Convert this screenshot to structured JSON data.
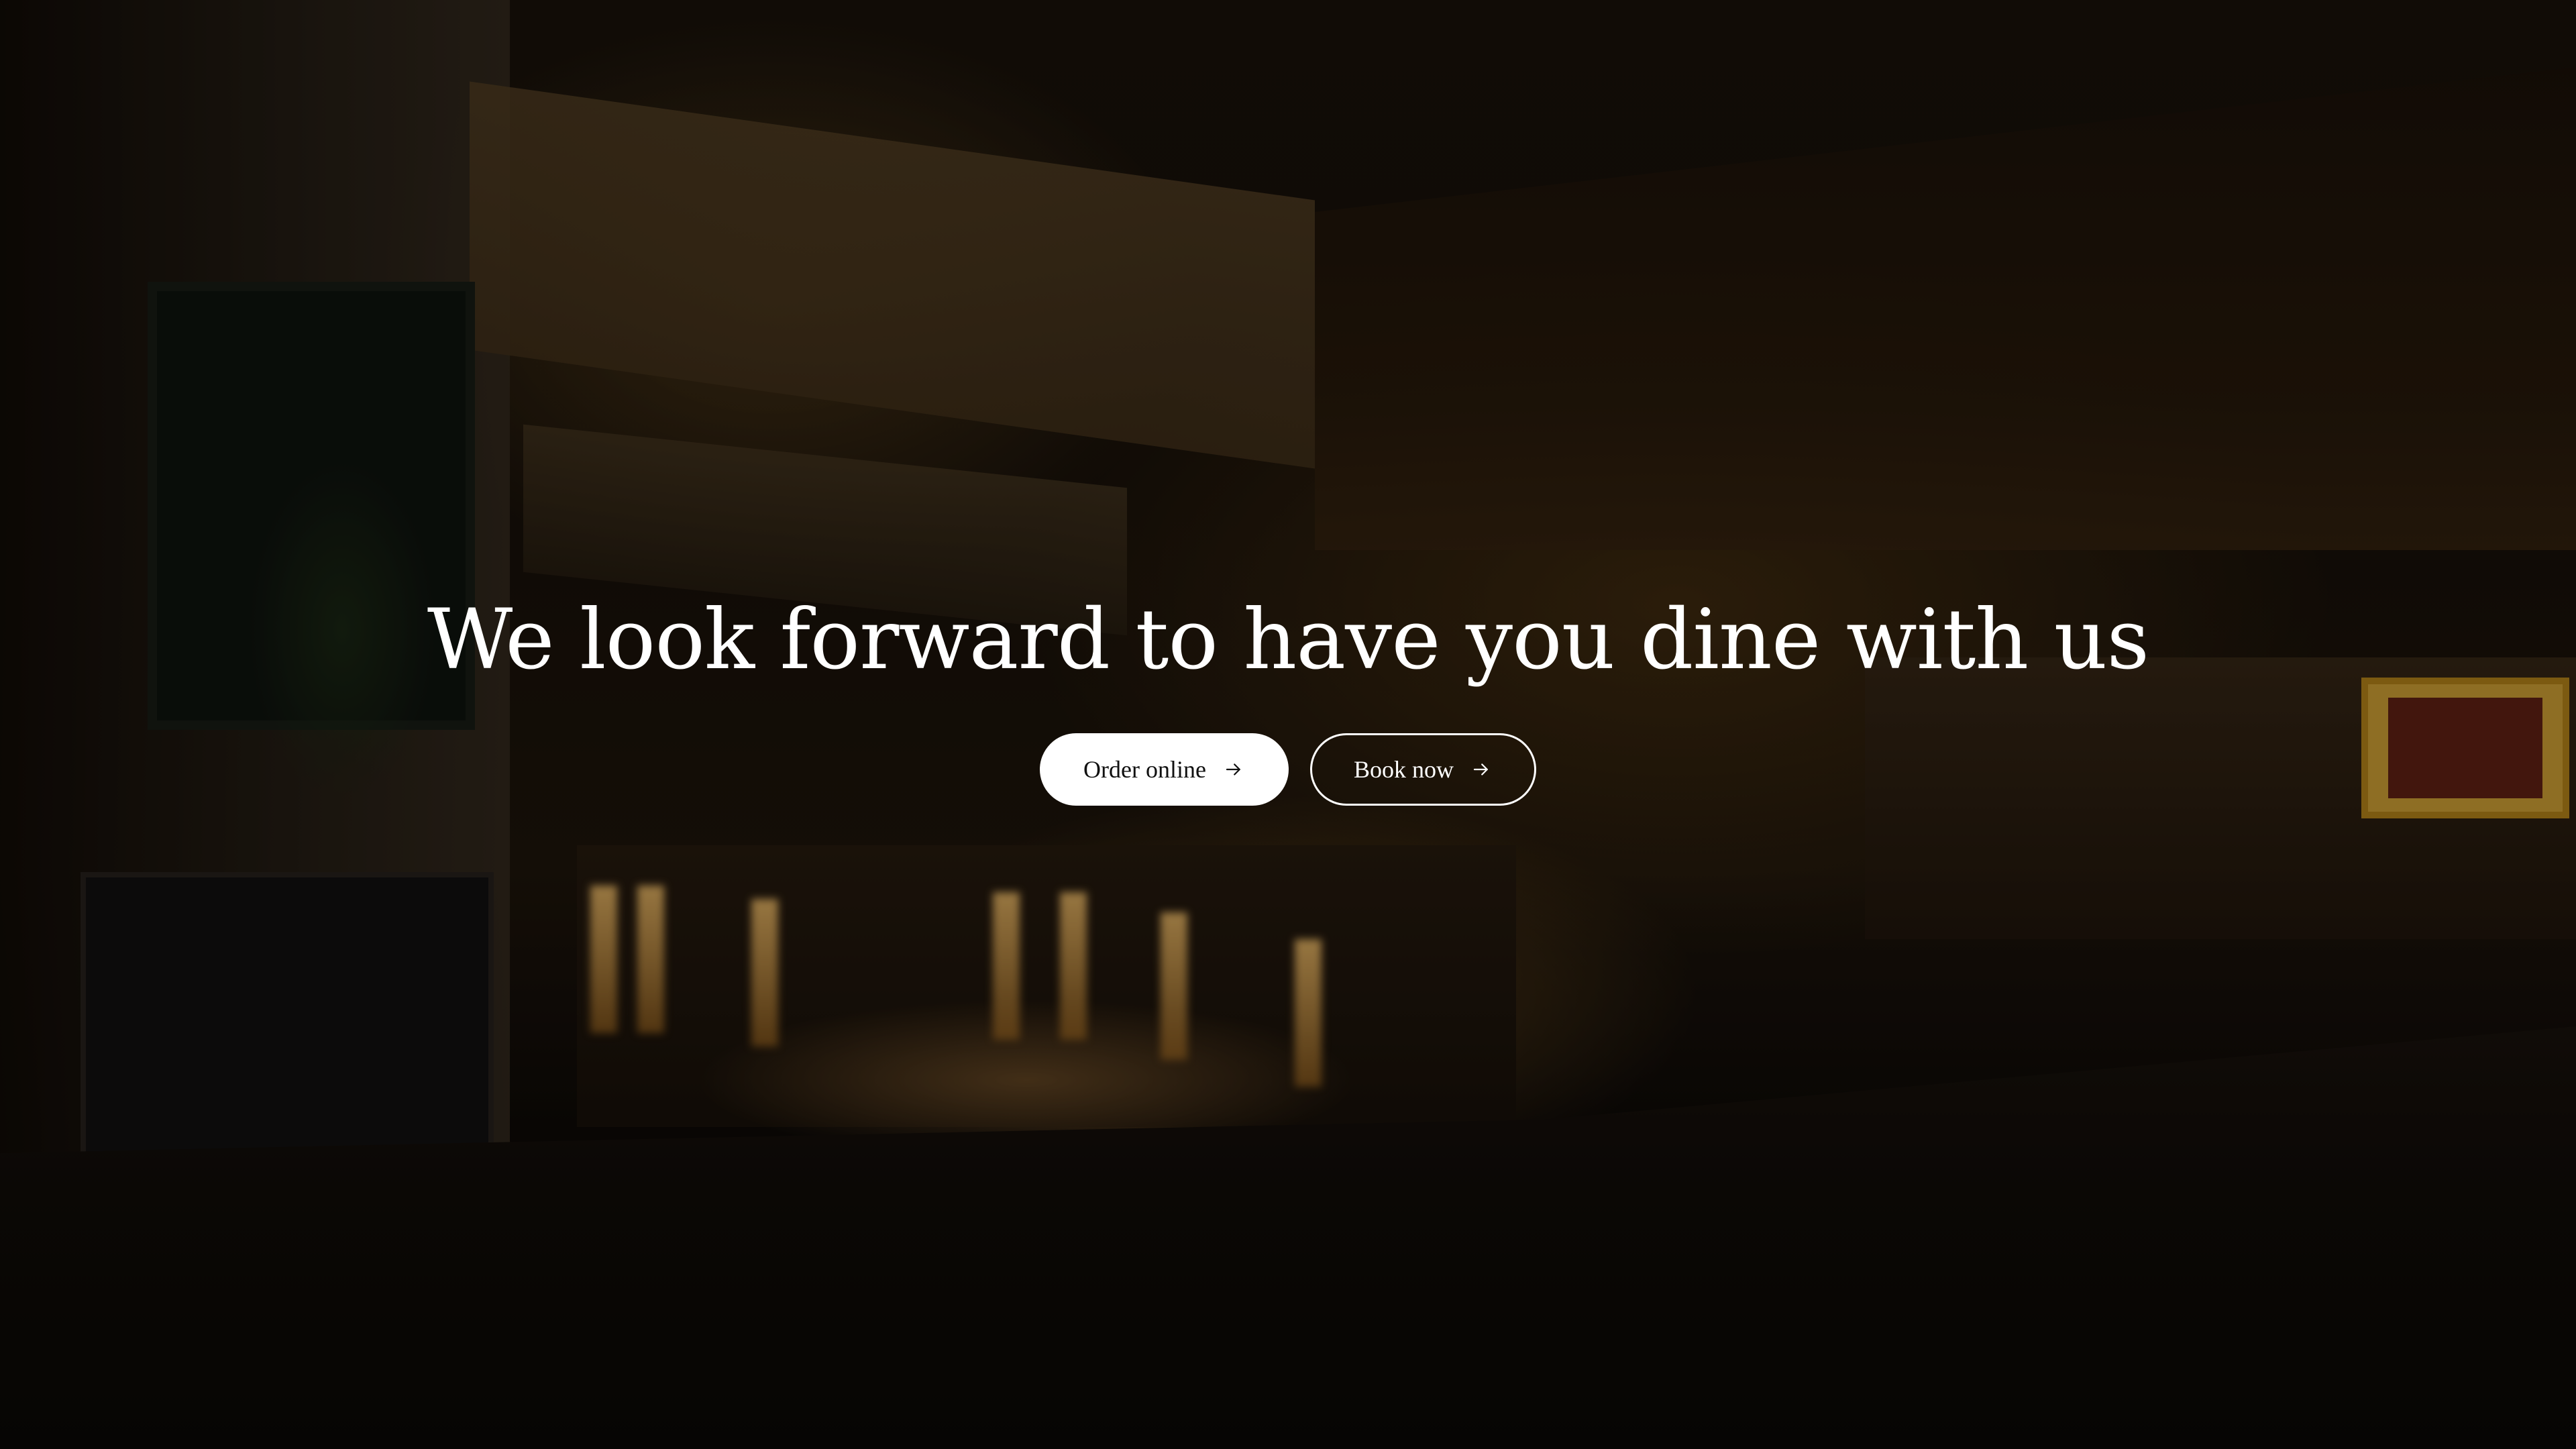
{
  "hero": {
    "headline": "We look forward to have you dine with us",
    "buttons": [
      {
        "label": "Order online",
        "icon": "arrow-right-icon"
      },
      {
        "label": "Book now",
        "icon": "arrow-right-icon"
      }
    ]
  },
  "colors": {
    "overlay": "#000000",
    "primary_button_bg": "#ffffff",
    "primary_button_text": "#111111",
    "outline_button_border": "#ffffff",
    "headline_text": "#ffffff"
  }
}
